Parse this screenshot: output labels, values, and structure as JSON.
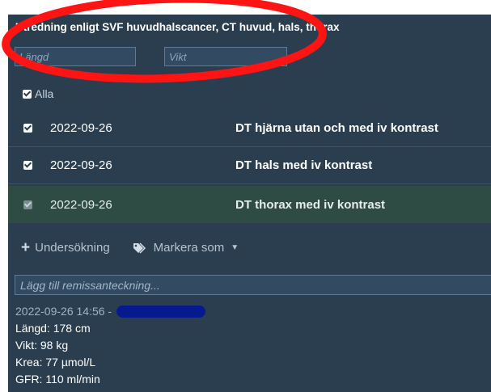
{
  "header": {
    "title": "Utredning enligt SVF huvudhalscancer, CT huvud, hals, thorax"
  },
  "fields": {
    "length_placeholder": "Längd",
    "weight_placeholder": "Vikt"
  },
  "select_all": {
    "label": "Alla",
    "checked": true
  },
  "exams": [
    {
      "date": "2022-09-26",
      "name": "DT hjärna utan och med iv kontrast",
      "checked": true,
      "selected": false
    },
    {
      "date": "2022-09-26",
      "name": "DT hals med iv kontrast",
      "checked": true,
      "selected": false
    },
    {
      "date": "2022-09-26",
      "name": "DT thorax med iv kontrast",
      "checked": true,
      "selected": true
    }
  ],
  "toolbar": {
    "add_exam_label": "Undersökning",
    "mark_as_label": "Markera som"
  },
  "note": {
    "placeholder": "Lägg till remissanteckning..."
  },
  "note_entry": {
    "timestamp": "2022-09-26 14:56 -",
    "lines": [
      "Längd:  178 cm",
      "Vikt: 98  kg",
      "Krea:  77 µmol/L",
      "GFR: 110 ml/min"
    ]
  },
  "colors": {
    "panel_bg": "#2b3e50",
    "selected_row_bg": "#2f4c44",
    "annotation_ring": "#ff1414",
    "redaction": "#061a8f"
  },
  "icons": {
    "add": "plus-icon",
    "tag": "tag-icon",
    "dropdown": "caret-down-icon",
    "checkbox": "checkbox-icon"
  }
}
